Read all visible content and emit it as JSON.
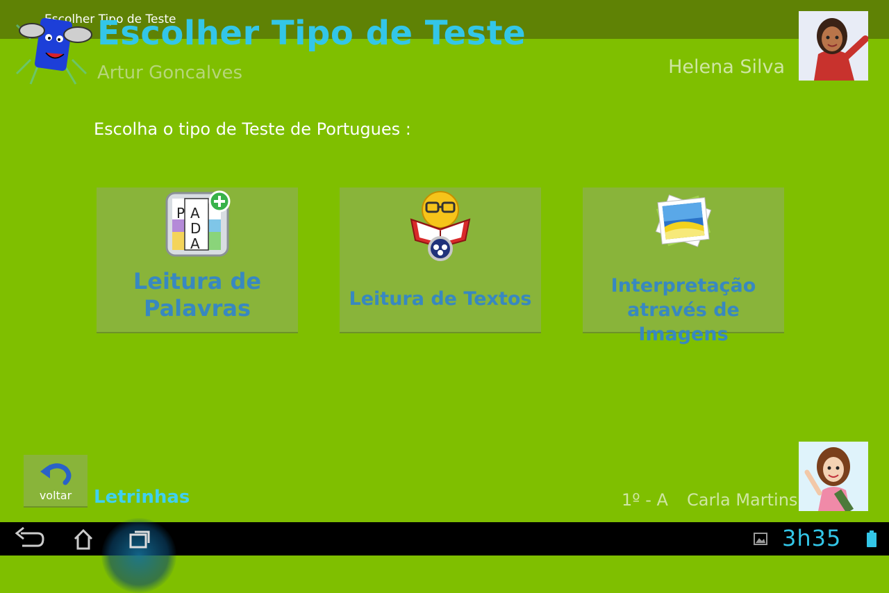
{
  "window": {
    "title": "Escolher Tipo de Teste"
  },
  "header": {
    "title": "Escolher Tipo de Teste",
    "student": "Artur Goncalves",
    "teacher": "Helena Silva"
  },
  "main": {
    "prompt": "Escolha o tipo de Teste de Portugues :",
    "options": [
      {
        "line1": "Leitura de",
        "line2": "Palavras",
        "icon": "word-puzzle-icon"
      },
      {
        "line1": "Leitura de Textos",
        "line2": "",
        "icon": "reading-book-icon"
      },
      {
        "line1": "Interpretação",
        "line2": "através de Imagens",
        "icon": "photos-icon"
      }
    ]
  },
  "footer": {
    "back_label": "voltar",
    "brand": "Letrinhas",
    "class": "1º - A",
    "user": "Carla Martins"
  },
  "system": {
    "clock": "3h35"
  },
  "colors": {
    "background": "#7fbf00",
    "title": "#33c6e8",
    "option_bg": "#89b43a",
    "option_text": "#3888c0",
    "brand": "#3fd0f0"
  }
}
